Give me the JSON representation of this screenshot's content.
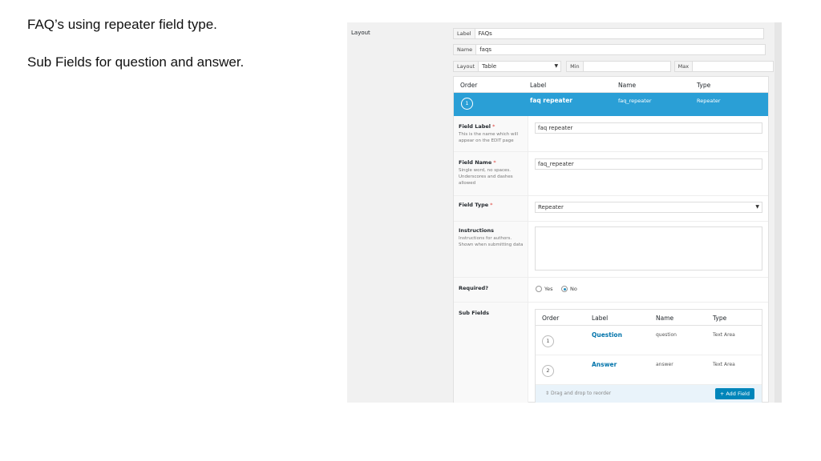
{
  "slide": {
    "line1": "FAQ’s using repeater field type.",
    "line2": "Sub Fields for question and answer."
  },
  "screenshot": {
    "section_label": "Layout",
    "meta": {
      "label_caption": "Label",
      "label_value": "FAQs",
      "name_caption": "Name",
      "name_value": "faqs",
      "layout_caption": "Layout",
      "layout_value": "Table",
      "min_caption": "Min",
      "max_caption": "Max"
    },
    "table_header": {
      "order": "Order",
      "label": "Label",
      "name": "Name",
      "type": "Type"
    },
    "selected_field": {
      "order": "1",
      "label": "faq repeater",
      "name": "faq_repeater",
      "type": "Repeater"
    },
    "settings": {
      "field_label": {
        "title": "Field Label",
        "required": "*",
        "desc": "This is the name which will appear on the EDIT page",
        "value": "faq repeater"
      },
      "field_name": {
        "title": "Field Name",
        "required": "*",
        "desc": "Single word, no spaces. Underscores and dashes allowed",
        "value": "faq_repeater"
      },
      "field_type": {
        "title": "Field Type",
        "required": "*",
        "value": "Repeater"
      },
      "instructions": {
        "title": "Instructions",
        "desc": "Instructions for authors. Shown when submitting data"
      },
      "required": {
        "title": "Required?",
        "yes": "Yes",
        "no": "No"
      },
      "sub_fields": {
        "title": "Sub Fields"
      }
    },
    "sub_header": {
      "order": "Order",
      "label": "Label",
      "name": "Name",
      "type": "Type"
    },
    "sub_rows": [
      {
        "order": "1",
        "label": "Question",
        "name": "question",
        "type": "Text Area"
      },
      {
        "order": "2",
        "label": "Answer",
        "name": "answer",
        "type": "Text Area"
      }
    ],
    "drag_hint": "Drag and drop to reorder",
    "add_field_label": "+ Add Field",
    "accent_color": "#2a9fd6"
  }
}
